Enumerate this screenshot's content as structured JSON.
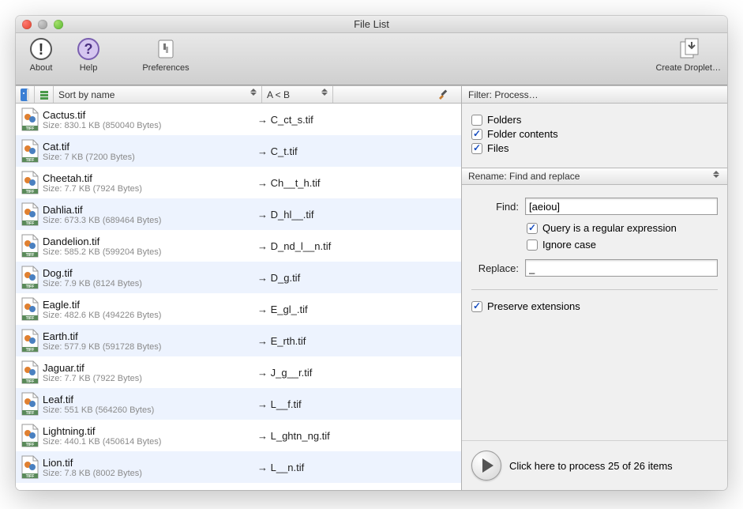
{
  "window": {
    "title": "File List"
  },
  "toolbar": {
    "about": "About",
    "help": "Help",
    "preferences": "Preferences",
    "droplet": "Create Droplet…"
  },
  "columns": {
    "sort": "Sort by name",
    "ab": "A < B"
  },
  "files": [
    {
      "name": "Cactus.tif",
      "size": "Size: 830.1 KB (850040 Bytes)",
      "newname": "→ C_ct_s.tif"
    },
    {
      "name": "Cat.tif",
      "size": "Size: 7 KB (7200 Bytes)",
      "newname": "→ C_t.tif"
    },
    {
      "name": "Cheetah.tif",
      "size": "Size: 7.7 KB (7924 Bytes)",
      "newname": "→ Ch__t_h.tif"
    },
    {
      "name": "Dahlia.tif",
      "size": "Size: 673.3 KB (689464 Bytes)",
      "newname": "→ D_hl__.tif"
    },
    {
      "name": "Dandelion.tif",
      "size": "Size: 585.2 KB (599204 Bytes)",
      "newname": "→ D_nd_l__n.tif"
    },
    {
      "name": "Dog.tif",
      "size": "Size: 7.9 KB (8124 Bytes)",
      "newname": "→ D_g.tif"
    },
    {
      "name": "Eagle.tif",
      "size": "Size: 482.6 KB (494226 Bytes)",
      "newname": "→ E_gl_.tif"
    },
    {
      "name": "Earth.tif",
      "size": "Size: 577.9 KB (591728 Bytes)",
      "newname": "→ E_rth.tif"
    },
    {
      "name": "Jaguar.tif",
      "size": "Size: 7.7 KB (7922 Bytes)",
      "newname": "→ J_g__r.tif"
    },
    {
      "name": "Leaf.tif",
      "size": "Size: 551 KB (564260 Bytes)",
      "newname": "→ L__f.tif"
    },
    {
      "name": "Lightning.tif",
      "size": "Size: 440.1 KB (450614 Bytes)",
      "newname": "→ L_ghtn_ng.tif"
    },
    {
      "name": "Lion.tif",
      "size": "Size: 7.8 KB (8002 Bytes)",
      "newname": "→ L__n.tif"
    }
  ],
  "filter": {
    "header": "Filter: Process…",
    "folders": "Folders",
    "folder_contents": "Folder contents",
    "files": "Files"
  },
  "rename": {
    "header": "Rename: Find and replace",
    "find_label": "Find:",
    "find_value": "[aeiou]",
    "regex": "Query is a regular expression",
    "ignore": "Ignore case",
    "replace_label": "Replace:",
    "replace_value": "_",
    "preserve": "Preserve extensions"
  },
  "process": {
    "text": "Click here to process 25 of 26 items"
  }
}
